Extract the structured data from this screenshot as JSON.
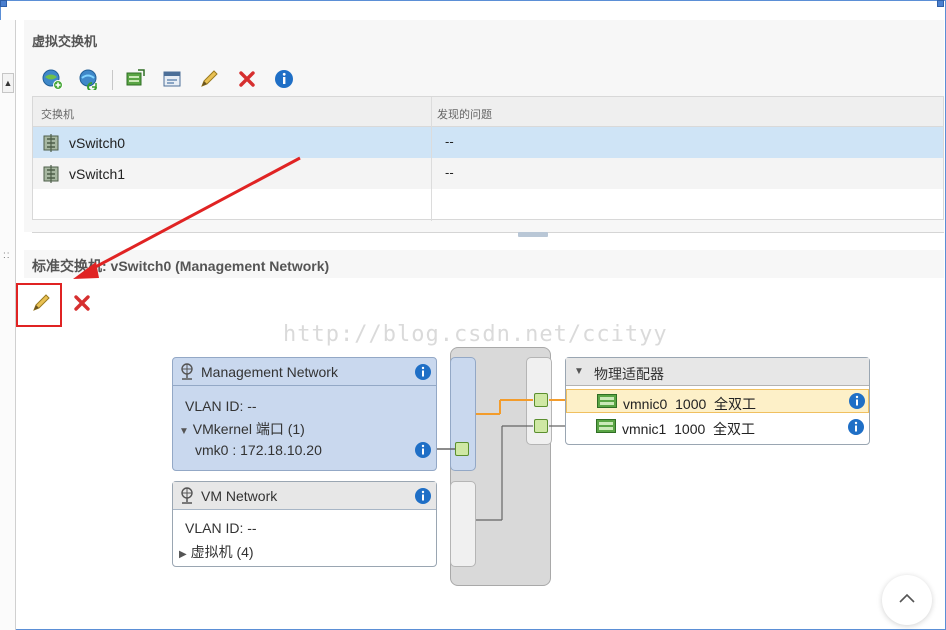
{
  "virtual_switches": {
    "title": "虚拟交换机",
    "toolbar": [
      {
        "name": "add-network-icon"
      },
      {
        "name": "refresh-icon"
      },
      {
        "name": "move-adapter-icon"
      },
      {
        "name": "settings-icon"
      },
      {
        "name": "edit-icon"
      },
      {
        "name": "delete-icon"
      },
      {
        "name": "info-icon"
      }
    ],
    "columns": [
      "交换机",
      "发现的问题"
    ],
    "rows": [
      {
        "name": "vSwitch0",
        "issues": "--",
        "selected": true
      },
      {
        "name": "vSwitch1",
        "issues": "--",
        "selected": false
      }
    ]
  },
  "standard_switch": {
    "title": "标准交换机: vSwitch0 (Management Network)",
    "toolbar": [
      {
        "name": "edit-icon",
        "highlighted": true
      },
      {
        "name": "delete-icon"
      }
    ]
  },
  "watermark": "http://blog.csdn.net/ccityy",
  "topology": {
    "port_groups": [
      {
        "name": "Management Network",
        "vlan": "VLAN ID: --",
        "sub_header": "VMkernel 端口 (1)",
        "sub_item": "vmk0 : 172.18.10.20",
        "expanded": true
      },
      {
        "name": "VM Network",
        "vlan": "VLAN ID: --",
        "sub_header": "虚拟机 (4)",
        "expanded": false
      }
    ],
    "physical_adapters": {
      "title": "物理适配器",
      "items": [
        {
          "label": "vmnic0  1000  全双工",
          "active": true
        },
        {
          "label": "vmnic1  1000  全双工",
          "active": false
        }
      ]
    }
  },
  "colors": {
    "accent_blue": "#1f6fc6",
    "selection": "#cfe4f6",
    "link_orange": "#f39c2b",
    "annotation_red": "#e02323"
  }
}
